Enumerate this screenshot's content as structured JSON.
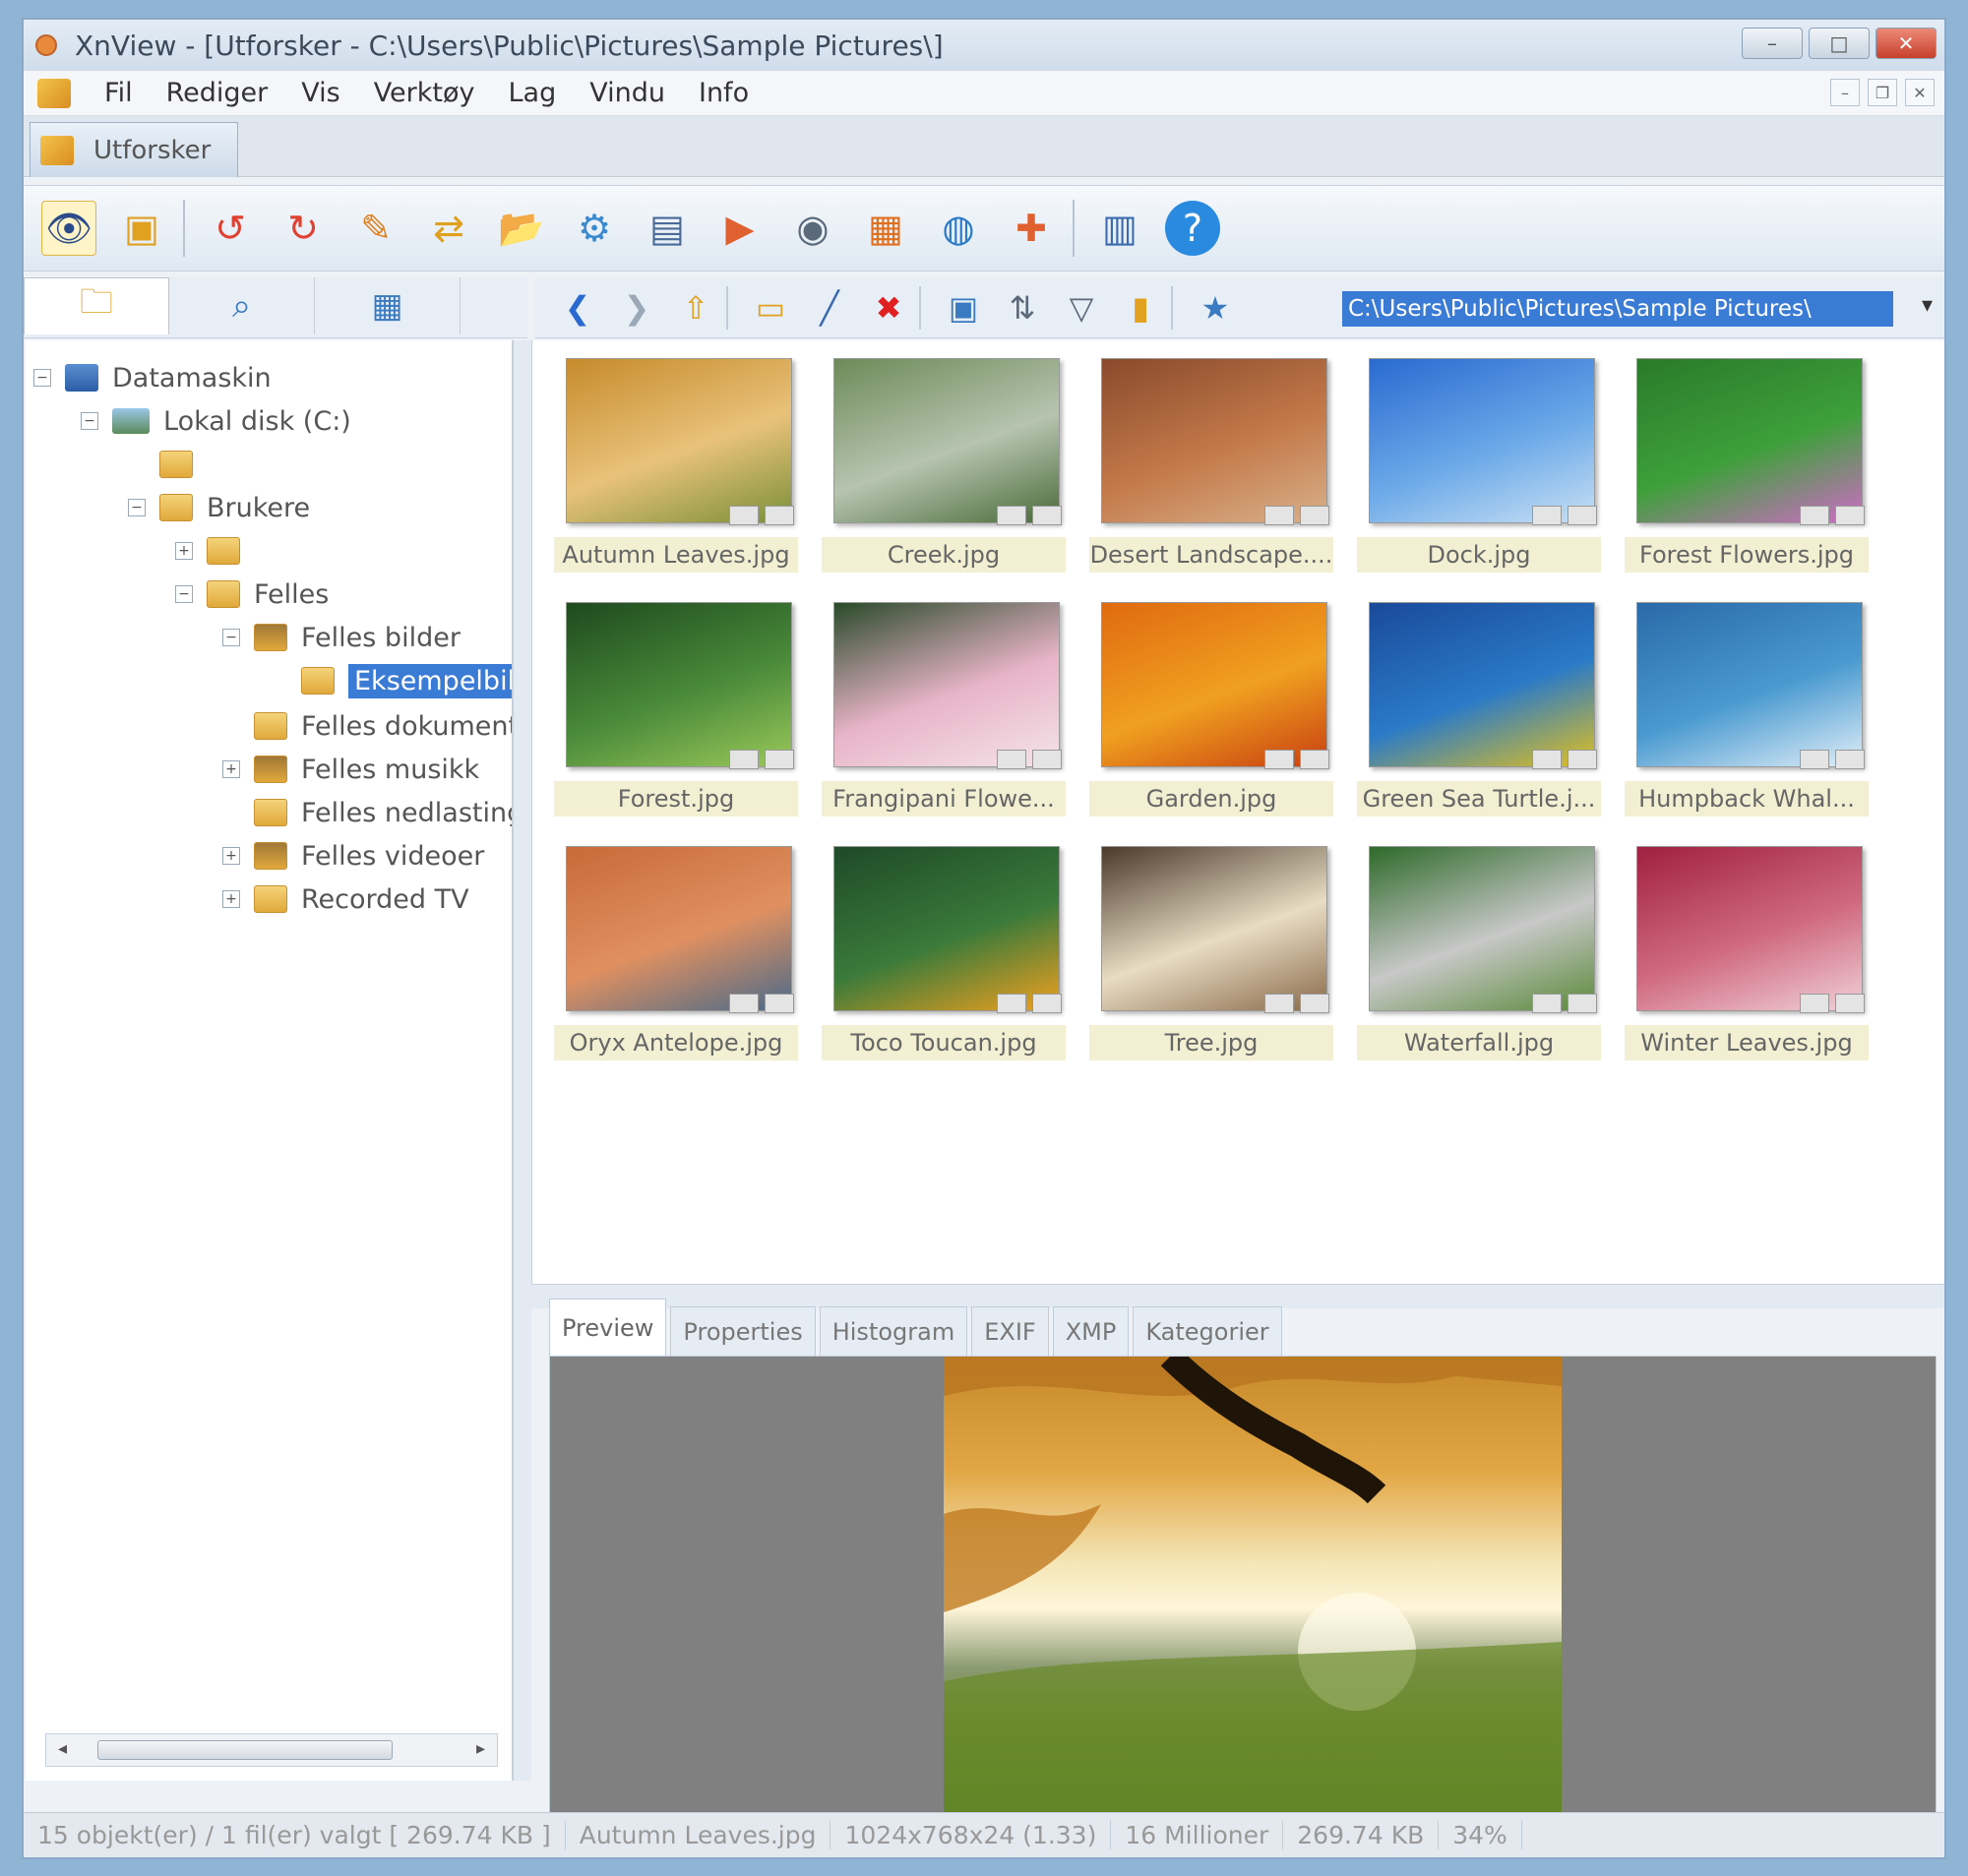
{
  "window": {
    "title": "XnView - [Utforsker - C:\\Users\\Public\\Pictures\\Sample Pictures\\]"
  },
  "menu": [
    "Fil",
    "Rediger",
    "Vis",
    "Verktøy",
    "Lag",
    "Vindu",
    "Info"
  ],
  "doc_tab": "Utforsker",
  "toolbar_icons": [
    "eye-icon",
    "browser-icon",
    "rotate-left-icon",
    "rotate-right-icon",
    "edit-icon",
    "convert-icon",
    "folder-open-icon",
    "settings-icon",
    "scanner-icon",
    "slideshow-icon",
    "camera-icon",
    "screen-icon",
    "web-icon",
    "puzzle-icon",
    "book-icon",
    "help-icon"
  ],
  "address": {
    "path": "C:\\Users\\Public\\Pictures\\Sample Pictures\\"
  },
  "tree": [
    {
      "label": "Datamaskin",
      "level": 0,
      "icon": "computer"
    },
    {
      "label": "Lokal disk (C:)",
      "level": 1,
      "icon": "drive"
    },
    {
      "label": "",
      "level": 2,
      "icon": "folder"
    },
    {
      "label": "Brukere",
      "level": 2,
      "icon": "folder"
    },
    {
      "label": "",
      "level": 3,
      "icon": "folder"
    },
    {
      "label": "Felles",
      "level": 3,
      "icon": "folder"
    },
    {
      "label": "Felles bilder",
      "level": 4,
      "icon": "folder"
    },
    {
      "label": "Eksempelbilder",
      "level": 5,
      "icon": "folder",
      "selected": true
    },
    {
      "label": "Felles dokumenter",
      "level": 4,
      "icon": "folder"
    },
    {
      "label": "Felles musikk",
      "level": 4,
      "icon": "folder"
    },
    {
      "label": "Felles nedlasting",
      "level": 4,
      "icon": "folder"
    },
    {
      "label": "Felles videoer",
      "level": 4,
      "icon": "folder"
    },
    {
      "label": "Recorded TV",
      "level": 4,
      "icon": "folder"
    }
  ],
  "thumbnails": [
    {
      "name": "Autumn Leaves.jpg",
      "colors": [
        "#c68b2c",
        "#e9c27a",
        "#7a8f3a"
      ]
    },
    {
      "name": "Creek.jpg",
      "colors": [
        "#6e8a58",
        "#b6c4b0",
        "#4a6a38"
      ]
    },
    {
      "name": "Desert Landscape....",
      "colors": [
        "#8a4a2c",
        "#c47a4a",
        "#d8b08a"
      ]
    },
    {
      "name": "Dock.jpg",
      "colors": [
        "#2a6ad0",
        "#6aa8e8",
        "#c8e0f4"
      ]
    },
    {
      "name": "Forest Flowers.jpg",
      "colors": [
        "#2a7a2a",
        "#3ea03a",
        "#d06ac8"
      ]
    },
    {
      "name": "Forest.jpg",
      "colors": [
        "#1e4a1e",
        "#4a8a3a",
        "#9ac85a"
      ]
    },
    {
      "name": "Frangipani Flowe...",
      "colors": [
        "#2a4a2a",
        "#e8b4c8",
        "#f4e4e8"
      ]
    },
    {
      "name": "Garden.jpg",
      "colors": [
        "#e06a10",
        "#f0a020",
        "#c84010"
      ]
    },
    {
      "name": "Green Sea Turtle.j...",
      "colors": [
        "#1a4a9a",
        "#2a7ac8",
        "#e0c020"
      ]
    },
    {
      "name": "Humpback Whal...",
      "colors": [
        "#2a6aa8",
        "#4a9ad0",
        "#e0eef8"
      ]
    },
    {
      "name": "Oryx Antelope.jpg",
      "colors": [
        "#c86a3a",
        "#e09060",
        "#4a6a8a"
      ]
    },
    {
      "name": "Toco Toucan.jpg",
      "colors": [
        "#1e4a28",
        "#3a7a3a",
        "#f0a020"
      ]
    },
    {
      "name": "Tree.jpg",
      "colors": [
        "#4a3a2a",
        "#e8dcc4",
        "#8a6a4a"
      ]
    },
    {
      "name": "Waterfall.jpg",
      "colors": [
        "#2e6a2a",
        "#c8c8c8",
        "#5a8a3a"
      ]
    },
    {
      "name": "Winter Leaves.jpg",
      "colors": [
        "#a02040",
        "#d06a80",
        "#f0d0d8"
      ]
    }
  ],
  "preview_tabs": [
    "Preview",
    "Properties",
    "Histogram",
    "EXIF",
    "XMP",
    "Kategorier"
  ],
  "status": [
    "15 objekt(er) / 1 fil(er) valgt [ 269.74 KB ]",
    "Autumn Leaves.jpg",
    "1024x768x24 (1.33)",
    "16 Millioner",
    "269.74 KB",
    "34%"
  ]
}
